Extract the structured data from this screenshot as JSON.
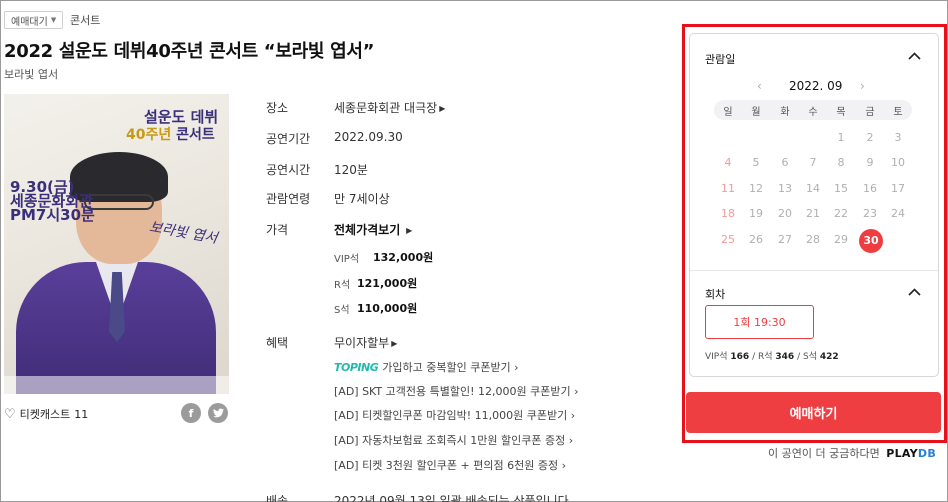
{
  "header": {
    "genre_select": "예매대기",
    "genre_current": "콘서트",
    "title": "2022 설운도 데뷔40주년 콘서트 “보라빛 엽서”",
    "subtitle": "보라빛 엽서"
  },
  "poster": {
    "title_line1": "설운도 데뷔",
    "title_line2_accent": "40주년",
    "title_line2_rest": "콘서트",
    "date_line1": "9.30(금)",
    "date_line2": "세종문화회관",
    "date_line3": "PM7시30분",
    "sign": "보라빛 엽서"
  },
  "social": {
    "like_label": "티켓캐스트",
    "like_count": "11",
    "facebook": "f",
    "twitter": "t"
  },
  "info": {
    "venue_label": "장소",
    "venue_value": "세종문화회관 대극장",
    "period_label": "공연기간",
    "period_value": "2022.09.30",
    "runtime_label": "공연시간",
    "runtime_value": "120분",
    "age_label": "관람연령",
    "age_value": "만 7세이상",
    "price_label": "가격",
    "price_all": "전체가격보기",
    "prices": [
      {
        "grade": "VIP석",
        "amount": "132,000원"
      },
      {
        "grade": "R석",
        "amount": "121,000원"
      },
      {
        "grade": "S석",
        "amount": "110,000원"
      }
    ],
    "benefit_label": "혜택",
    "benefit_value": "무이자할부",
    "toping": "TOPING",
    "benefits": [
      "가입하고 중복할인 쿠폰받기",
      "[AD] SKT 고객전용 특별할인! 12,000원 쿠폰받기",
      "[AD] 티켓할인쿠폰 마감임박! 11,000원 쿠폰받기",
      "[AD] 자동차보험료 조회즉시 1만원 할인쿠폰 증정",
      "[AD] 티켓 3천원 할인쿠폰 + 편의점 6천원 증정"
    ],
    "delivery_label": "배송",
    "delivery_value": "2022년 09월 13일 일괄 배송되는 상품입니다"
  },
  "booking": {
    "date_section": "관람일",
    "month": "2022. 09",
    "weekdays": [
      "일",
      "월",
      "화",
      "수",
      "목",
      "금",
      "토"
    ],
    "days": [
      "1",
      "2",
      "3",
      "4",
      "5",
      "6",
      "7",
      "8",
      "9",
      "10",
      "11",
      "12",
      "13",
      "14",
      "15",
      "16",
      "17",
      "18",
      "19",
      "20",
      "21",
      "22",
      "23",
      "24",
      "25",
      "26",
      "27",
      "28",
      "29",
      "30"
    ],
    "selected_day": "30",
    "round_section": "회차",
    "round_option": "1회 19:30",
    "seats": [
      {
        "grade": "VIP석",
        "count": "166"
      },
      {
        "grade": "R석",
        "count": "346"
      },
      {
        "grade": "S석",
        "count": "422"
      }
    ],
    "book_button": "예매하기",
    "playdb_text": "이 공연이 더 궁금하다면",
    "playdb_brand_a": "PLAY",
    "playdb_brand_b": "DB",
    "accent_color": "#ef3e42",
    "highlight_color": "#e8111a"
  }
}
